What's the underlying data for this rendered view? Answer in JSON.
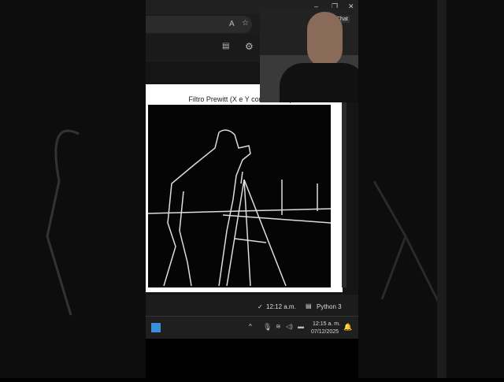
{
  "plot": {
    "title": "Filtro Prewitt (X e Y combinados)"
  },
  "browser": {
    "chat_label": "Chat"
  },
  "status": {
    "time": "12:12 a.m.",
    "kernel": "Python 3"
  },
  "taskbar": {
    "time": "12:15 a. m.",
    "date": "07/12/2025"
  }
}
